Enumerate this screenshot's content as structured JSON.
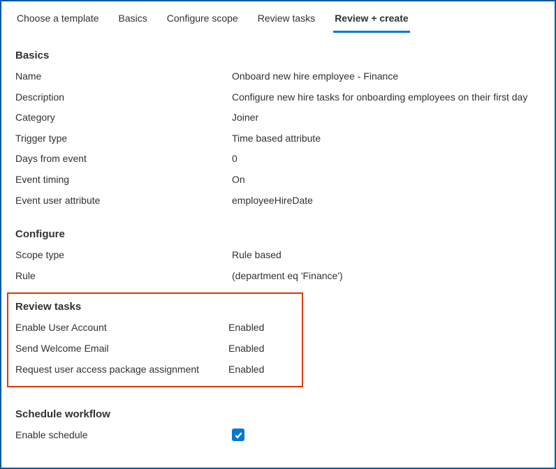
{
  "tabs": [
    {
      "label": "Choose a template",
      "active": false
    },
    {
      "label": "Basics",
      "active": false
    },
    {
      "label": "Configure scope",
      "active": false
    },
    {
      "label": "Review tasks",
      "active": false
    },
    {
      "label": "Review + create",
      "active": true
    }
  ],
  "sections": {
    "basics": {
      "title": "Basics",
      "rows": [
        {
          "label": "Name",
          "value": "Onboard new hire employee - Finance"
        },
        {
          "label": "Description",
          "value": "Configure new hire tasks for onboarding employees on their first day"
        },
        {
          "label": "Category",
          "value": "Joiner"
        },
        {
          "label": "Trigger type",
          "value": "Time based attribute"
        },
        {
          "label": "Days from event",
          "value": "0"
        },
        {
          "label": "Event timing",
          "value": "On"
        },
        {
          "label": "Event user attribute",
          "value": "employeeHireDate"
        }
      ]
    },
    "configure": {
      "title": "Configure",
      "rows": [
        {
          "label": "Scope type",
          "value": "Rule based"
        },
        {
          "label": "Rule",
          "value": " (department eq 'Finance')"
        }
      ]
    },
    "reviewTasks": {
      "title": "Review tasks",
      "rows": [
        {
          "label": "Enable User Account",
          "value": "Enabled"
        },
        {
          "label": "Send Welcome Email",
          "value": "Enabled"
        },
        {
          "label": "Request user access package assignment",
          "value": "Enabled"
        }
      ]
    },
    "schedule": {
      "title": "Schedule workflow",
      "rows": [
        {
          "label": "Enable schedule",
          "checked": true
        }
      ]
    }
  }
}
